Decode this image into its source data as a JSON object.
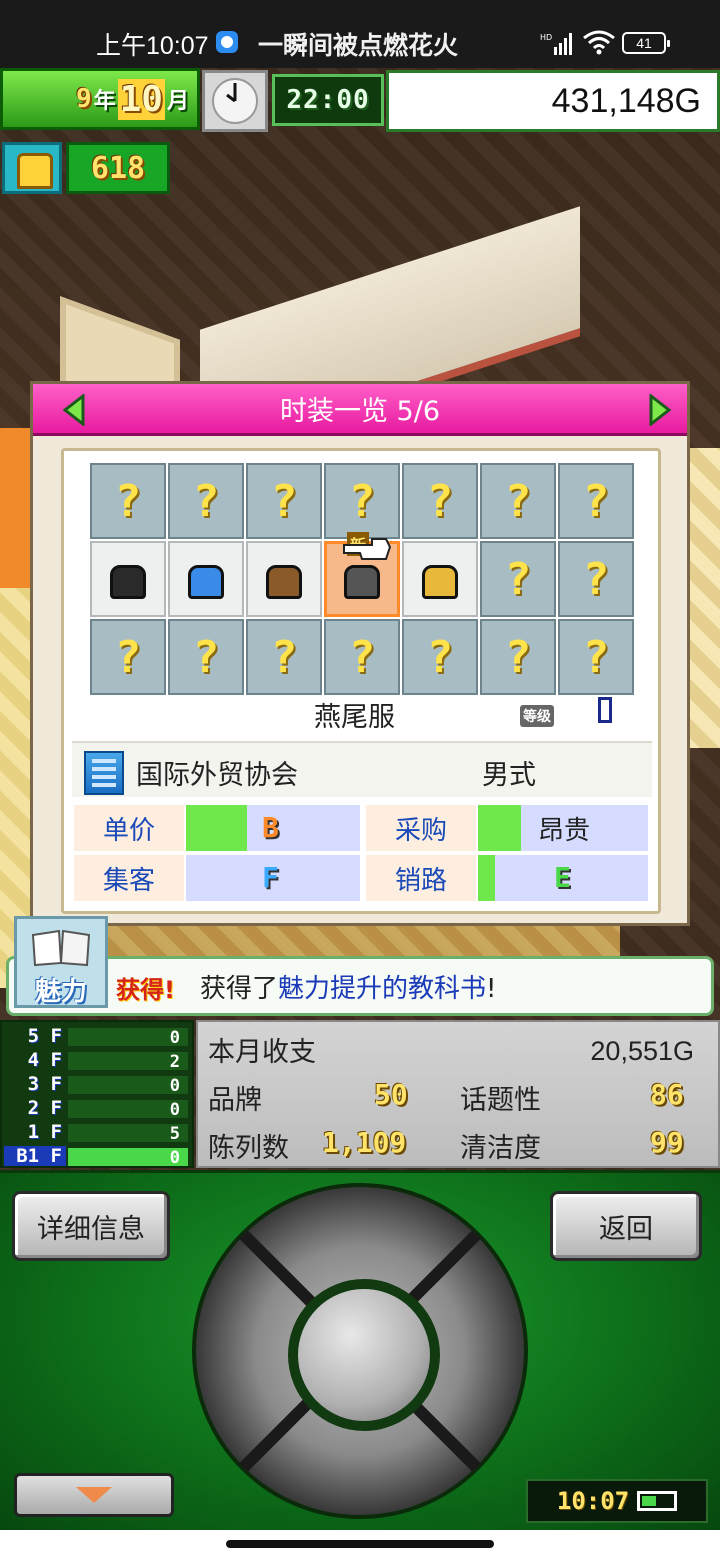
{
  "status_bar": {
    "time": "上午10:07",
    "notification": "一瞬间被点燃花火",
    "battery": "41"
  },
  "hud": {
    "year": "9",
    "year_unit": "年",
    "month": "10",
    "month_unit": "月",
    "time": "22:00",
    "money": "431,148G",
    "fashion_points": "618"
  },
  "dialog": {
    "title": "时装一览 5/6",
    "grid": [
      [
        "?",
        "?",
        "?",
        "?",
        "?",
        "?",
        "?"
      ],
      [
        "black-coat",
        "blue-jacket",
        "brown-coat",
        "tailcoat",
        "gold-vest",
        "?",
        "?"
      ],
      [
        "?",
        "?",
        "?",
        "?",
        "?",
        "?",
        "?"
      ]
    ],
    "new_badge": "新",
    "item_name": "燕尾服",
    "level_label": "等级",
    "company": "国际外贸协会",
    "gender": "男式",
    "stats": {
      "unit_price_label": "单价",
      "unit_price_grade": "B",
      "unit_price_level": 0.35,
      "purchase_label": "采购",
      "purchase_text": "昂贵",
      "purchase_level": 0.25,
      "attraction_label": "集客",
      "attraction_grade": "F",
      "attraction_level": 0.0,
      "sales_label": "销路",
      "sales_grade": "E",
      "sales_level": 0.1
    }
  },
  "notification": {
    "category": "魅力",
    "tag": "获得!",
    "text_prefix": "获得了",
    "text_highlight": "魅力提升的教科书",
    "text_suffix": "!"
  },
  "floors": [
    {
      "label": "5 F",
      "value": "0"
    },
    {
      "label": "4 F",
      "value": "2"
    },
    {
      "label": "3 F",
      "value": "0"
    },
    {
      "label": "2 F",
      "value": "0"
    },
    {
      "label": "1 F",
      "value": "5"
    },
    {
      "label": "B1 F",
      "value": "0"
    }
  ],
  "stats_panel": {
    "balance_label": "本月收支",
    "balance_value": "20,551G",
    "brand_label": "品牌",
    "brand_value": "50",
    "topic_label": "话题性",
    "topic_value": "86",
    "display_label": "陈列数",
    "display_value": "1,109",
    "clean_label": "清洁度",
    "clean_value": "99"
  },
  "controls": {
    "detail_label": "详细信息",
    "back_label": "返回",
    "clock": "10:07"
  }
}
